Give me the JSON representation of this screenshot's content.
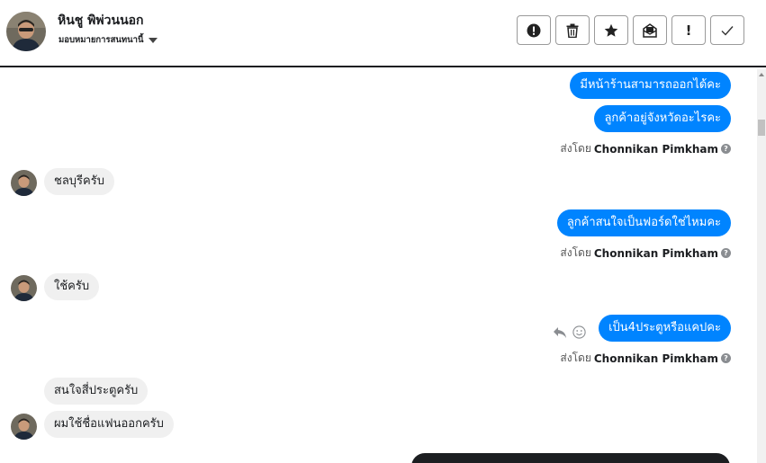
{
  "header": {
    "contact_name": "หินชู พิพ่วนนอก",
    "assign_label": "มอบหมายการสนทนานี้",
    "toolbar": [
      {
        "name": "alert-circle-icon"
      },
      {
        "name": "trash-icon"
      },
      {
        "name": "star-icon"
      },
      {
        "name": "mark-unread-icon"
      },
      {
        "name": "exclamation-icon",
        "text": "!"
      },
      {
        "name": "check-icon"
      }
    ]
  },
  "messages": {
    "out1": "มีหน้าร้านสามารถออกได้คะ",
    "out2": "ลูกค้าอยู่จังหวัดอะไรคะ",
    "sent_by_1_prefix": "ส่งโดย",
    "sent_by_1_name": "Chonnikan Pimkham",
    "in1": "ชลบุรีครับ",
    "out3": "ลูกค้าสนใจเป็นฟอร์ดใช่ไหมคะ",
    "sent_by_2_prefix": "ส่งโดย",
    "sent_by_2_name": "Chonnikan Pimkham",
    "in2": "ใช้ครับ",
    "out4": "เป็น4ประตูหรือแคปคะ",
    "sent_by_3_prefix": "ส่งโดย",
    "sent_by_3_name": "Chonnikan Pimkham",
    "in3": "สนใจสี่ประตูครับ",
    "in4": "ผมใช้ชื่อแฟนออกครับ",
    "help_glyph": "?"
  },
  "colors": {
    "outgoing_bubble": "#0084ff",
    "incoming_bubble": "#f0f0f0",
    "header_border": "#1c1e21"
  }
}
